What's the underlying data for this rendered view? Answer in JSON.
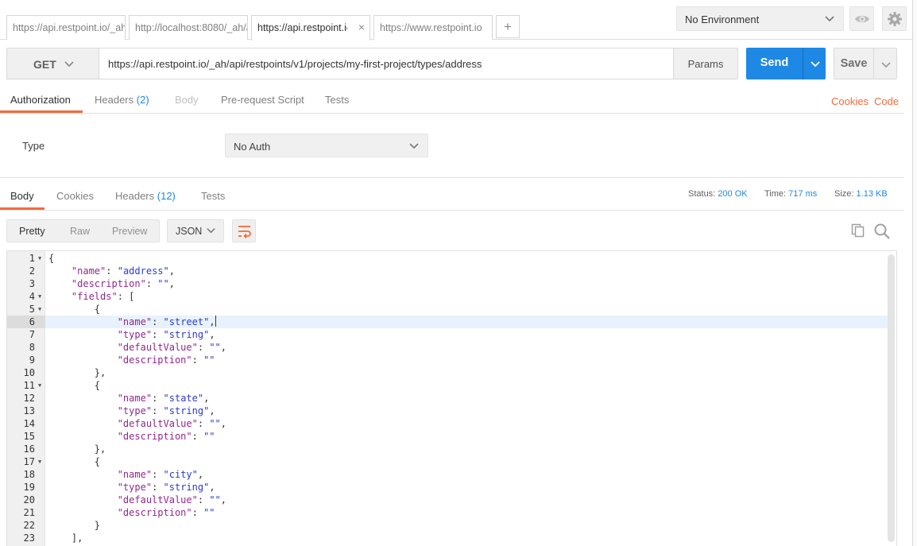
{
  "tabs": [
    {
      "label": "https://api.restpoint.io/_ah/",
      "active": false
    },
    {
      "label": "http://localhost:8080/_ah/ap",
      "active": false
    },
    {
      "label": "https://api.restpoint.io",
      "active": true
    },
    {
      "label": "https://www.restpoint.io",
      "active": false
    }
  ],
  "tab_add_label": "+",
  "tab_close_label": "×",
  "environment": {
    "selected": "No Environment"
  },
  "request": {
    "method": "GET",
    "url": "https://api.restpoint.io/_ah/api/restpoints/v1/projects/my-first-project/types/address",
    "params_label": "Params",
    "send_label": "Send",
    "save_label": "Save"
  },
  "request_tabs": {
    "authorization": "Authorization",
    "headers": "Headers",
    "headers_count": "(2)",
    "body": "Body",
    "prerequest": "Pre-request Script",
    "tests": "Tests",
    "cookies_link": "Cookies",
    "code_link": "Code"
  },
  "auth": {
    "type_label": "Type",
    "selected": "No Auth"
  },
  "response_tabs": {
    "body": "Body",
    "cookies": "Cookies",
    "headers": "Headers",
    "headers_count": "(12)",
    "tests": "Tests"
  },
  "status": {
    "status_label": "Status:",
    "status_value": "200 OK",
    "time_label": "Time:",
    "time_value": "717 ms",
    "size_label": "Size:",
    "size_value": "1.13 KB"
  },
  "viewer": {
    "pretty": "Pretty",
    "raw": "Raw",
    "preview": "Preview",
    "format": "JSON"
  },
  "code": {
    "highlighted_line": 6,
    "lines": [
      {
        "n": "1",
        "fold": true,
        "indent": 0,
        "text": "{"
      },
      {
        "n": "2",
        "indent": 1,
        "key": "\"name\"",
        "val": "\"address\"",
        "trail": ","
      },
      {
        "n": "3",
        "indent": 1,
        "key": "\"description\"",
        "val": "\"\"",
        "trail": ","
      },
      {
        "n": "4",
        "fold": true,
        "indent": 1,
        "key": "\"fields\"",
        "trail": "["
      },
      {
        "n": "5",
        "fold": true,
        "indent": 2,
        "text": "{"
      },
      {
        "n": "6",
        "indent": 3,
        "key": "\"name\"",
        "val": "\"street\"",
        "trail": ",",
        "cursor": true
      },
      {
        "n": "7",
        "indent": 3,
        "key": "\"type\"",
        "val": "\"string\"",
        "trail": ","
      },
      {
        "n": "8",
        "indent": 3,
        "key": "\"defaultValue\"",
        "val": "\"\"",
        "trail": ","
      },
      {
        "n": "9",
        "indent": 3,
        "key": "\"description\"",
        "val": "\"\"",
        "trail": ""
      },
      {
        "n": "10",
        "indent": 2,
        "text": "},"
      },
      {
        "n": "11",
        "fold": true,
        "indent": 2,
        "text": "{"
      },
      {
        "n": "12",
        "indent": 3,
        "key": "\"name\"",
        "val": "\"state\"",
        "trail": ","
      },
      {
        "n": "13",
        "indent": 3,
        "key": "\"type\"",
        "val": "\"string\"",
        "trail": ","
      },
      {
        "n": "14",
        "indent": 3,
        "key": "\"defaultValue\"",
        "val": "\"\"",
        "trail": ","
      },
      {
        "n": "15",
        "indent": 3,
        "key": "\"description\"",
        "val": "\"\"",
        "trail": ""
      },
      {
        "n": "16",
        "indent": 2,
        "text": "},"
      },
      {
        "n": "17",
        "fold": true,
        "indent": 2,
        "text": "{"
      },
      {
        "n": "18",
        "indent": 3,
        "key": "\"name\"",
        "val": "\"city\"",
        "trail": ","
      },
      {
        "n": "19",
        "indent": 3,
        "key": "\"type\"",
        "val": "\"string\"",
        "trail": ","
      },
      {
        "n": "20",
        "indent": 3,
        "key": "\"defaultValue\"",
        "val": "\"\"",
        "trail": ","
      },
      {
        "n": "21",
        "indent": 3,
        "key": "\"description\"",
        "val": "\"\"",
        "trail": ""
      },
      {
        "n": "22",
        "indent": 2,
        "text": "}"
      },
      {
        "n": "23",
        "indent": 1,
        "text": "],"
      }
    ]
  },
  "colors": {
    "accent_blue": "#1e88e5",
    "accent_orange": "#f26b3a",
    "json_key": "#92278f",
    "json_string": "#2a3bd0"
  },
  "icons": {
    "env_chevron": "chevron-down-icon",
    "quick_look": "eye-icon",
    "settings": "gear-icon",
    "wrap": "wrap-lines-icon",
    "copy": "copy-icon",
    "search": "search-icon"
  }
}
